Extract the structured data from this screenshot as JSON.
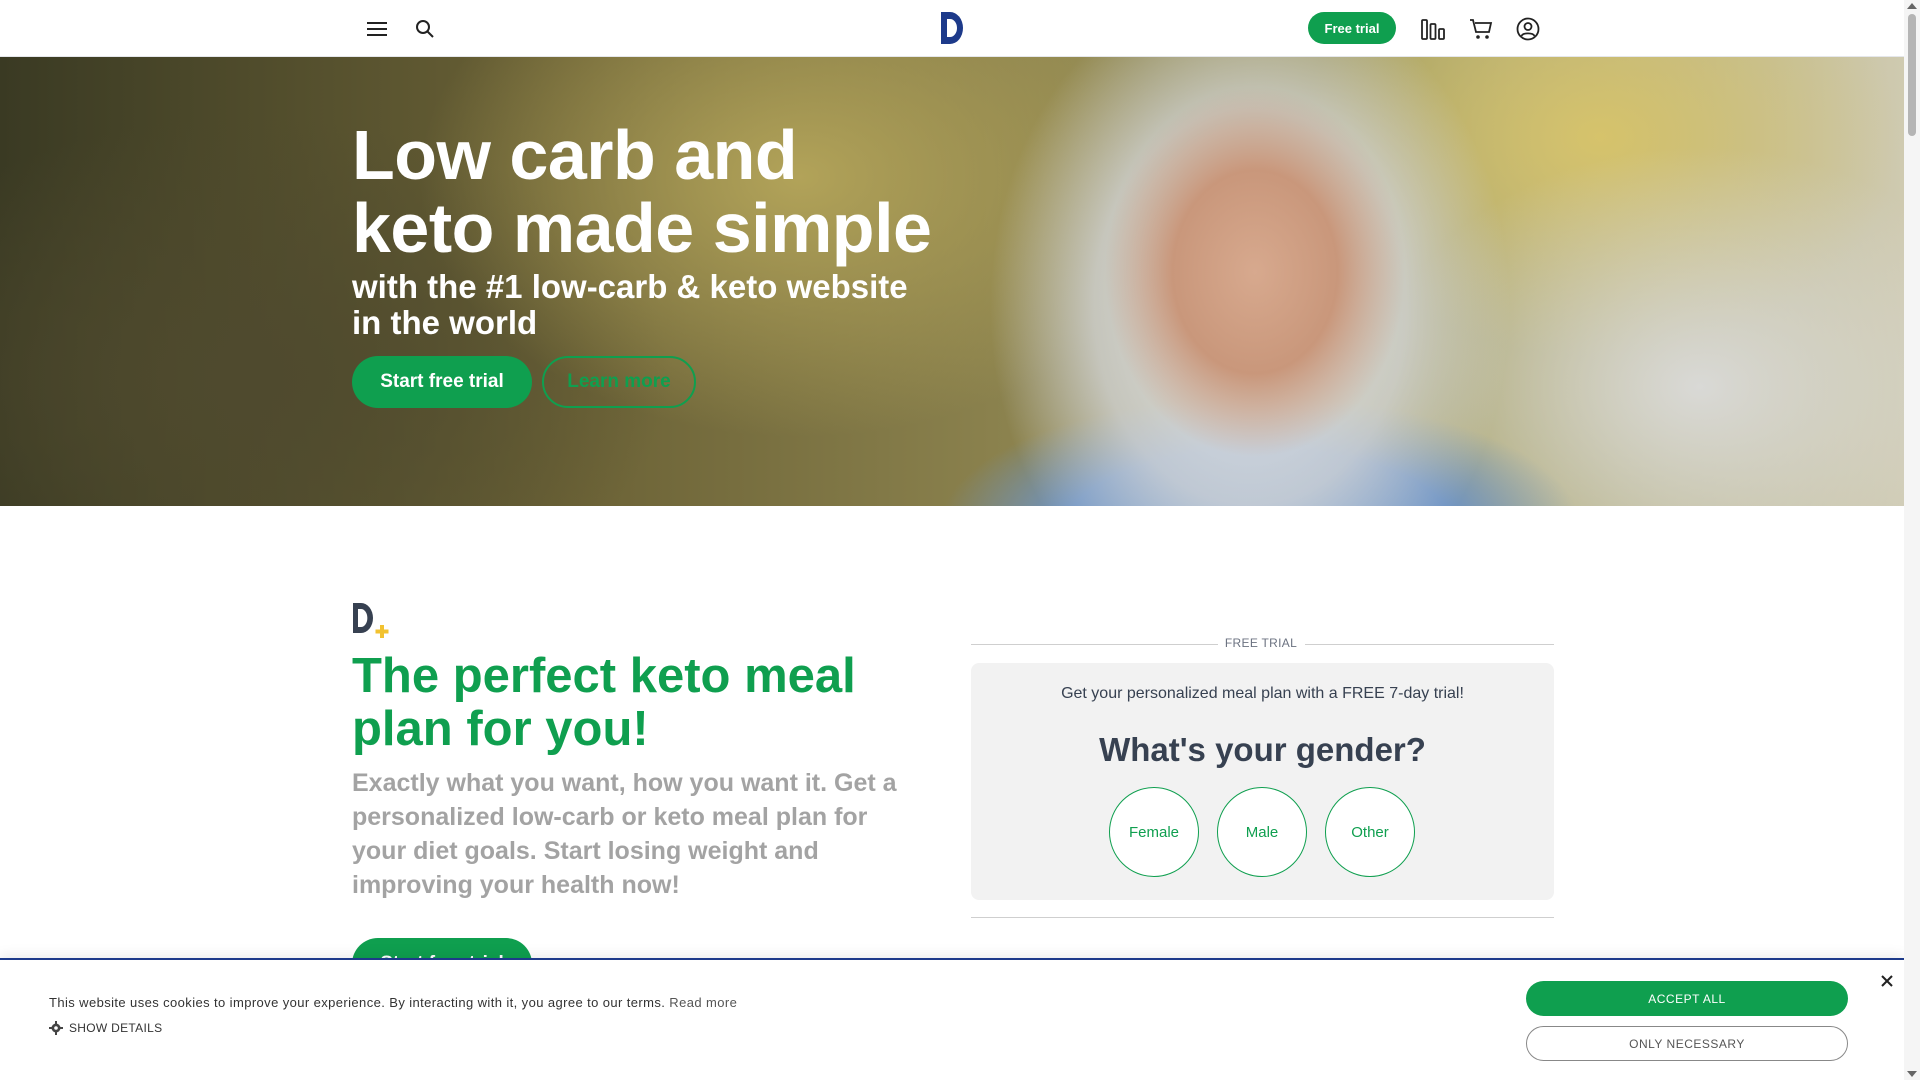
{
  "header": {
    "menu_icon": "hamburger-icon",
    "search_icon": "search-icon",
    "logo_icon": "diet-doctor-logo-icon",
    "free_trial_label": "Free trial",
    "stats_icon": "bar-chart-icon",
    "cart_icon": "cart-icon",
    "account_icon": "user-account-icon"
  },
  "hero": {
    "title_line1": "Low carb and",
    "title_line2": "keto made simple",
    "subtitle": "with the #1 low-carb & keto website in the world",
    "start_button": "Start free trial",
    "learn_button": "Learn more"
  },
  "meal_plan": {
    "title": "The perfect keto meal plan for you!",
    "description": "Exactly what you want, how you want it. Get a personalized low-carb or keto meal plan for your diet goals. Start losing weight and improving your health now!",
    "cta": "Start free trial"
  },
  "free_trial_card": {
    "section_label": "FREE TRIAL",
    "intro": "Get your personalized meal plan with a FREE 7-day trial!",
    "question": "What's your gender?",
    "options": [
      "Female",
      "Male",
      "Other"
    ]
  },
  "cookie_banner": {
    "text": "This website uses cookies to improve your experience. By interacting with it, you agree to our terms.",
    "read_more": "Read more",
    "show_details": "SHOW DETAILS",
    "accept_all": "ACCEPT ALL",
    "only_necessary": "ONLY NECESSARY",
    "close_icon": "close-icon"
  },
  "colors": {
    "brand_green": "#0f9f4f",
    "logo_blue": "#1d3a8a",
    "accent_yellow": "#f2c230"
  }
}
